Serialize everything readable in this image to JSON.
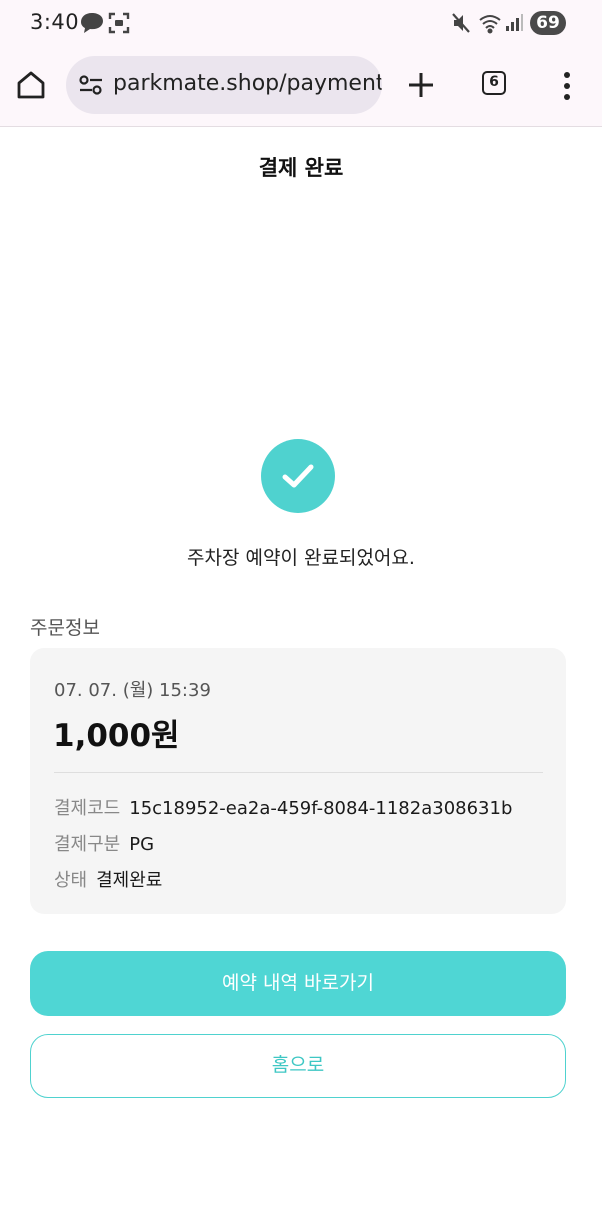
{
  "status_bar": {
    "time": "3:40",
    "battery": "69",
    "icons": [
      "chat-bubble-icon",
      "screen-capture-icon",
      "mute-icon",
      "wifi-icon",
      "signal-icon"
    ]
  },
  "browser": {
    "url": "parkmate.shop/payment",
    "tab_count": "6"
  },
  "page": {
    "title": "결제 완료",
    "complete_message": "주차장 예약이 완료되었어요.",
    "section_label": "주문정보",
    "order": {
      "date": "07. 07. (월) 15:39",
      "amount": "1,000원",
      "code_label": "결제코드",
      "code_value": "15c18952-ea2a-459f-8084-1182a308631b",
      "type_label": "결제구분",
      "type_value": "PG",
      "status_label": "상태",
      "status_value": "결제완료"
    },
    "buttons": {
      "reservations": "예약 내역 바로가기",
      "home": "홈으로"
    }
  },
  "colors": {
    "accent": "#4fd6d4",
    "card_bg": "#f5f5f5"
  }
}
